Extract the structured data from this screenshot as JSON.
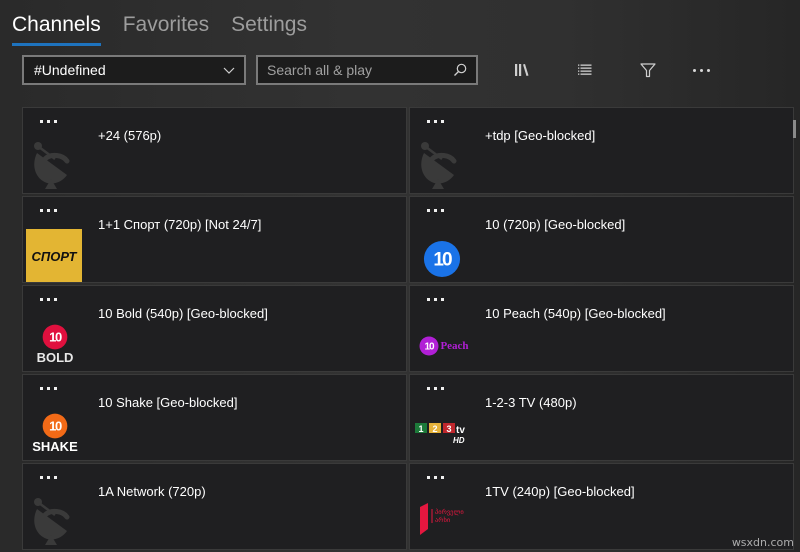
{
  "tabs": [
    {
      "label": "Channels",
      "active": true
    },
    {
      "label": "Favorites",
      "active": false
    },
    {
      "label": "Settings",
      "active": false
    }
  ],
  "toolbar": {
    "group_select_value": "#Undefined",
    "search_placeholder": "Search all & play",
    "search_value": "",
    "icons": [
      "library-icon",
      "list-icon",
      "filter-icon",
      "more-icon"
    ]
  },
  "channels": [
    {
      "title": "+24 (576p)",
      "logo": "satellite-dish"
    },
    {
      "title": "+tdp [Geo-blocked]",
      "logo": "satellite-dish"
    },
    {
      "title": "1+1 Спорт (720p) [Not 24/7]",
      "logo": "sport",
      "logo_text": "СПОРТ",
      "logo_color": "#e3b533"
    },
    {
      "title": "10 (720p) [Geo-blocked]",
      "logo": "ten",
      "logo_color": "#1a73e8"
    },
    {
      "title": "10 Bold (540p) [Geo-blocked]",
      "logo": "ten-bold",
      "logo_text": "BOLD",
      "logo_color": "#e0103e"
    },
    {
      "title": "10 Peach (540p) [Geo-blocked]",
      "logo": "ten-peach",
      "logo_text": "Peach",
      "logo_color": "#b11fd6"
    },
    {
      "title": "10 Shake [Geo-blocked]",
      "logo": "ten-shake",
      "logo_text": "SHAKE",
      "logo_color": "#f26a17"
    },
    {
      "title": "1-2-3 TV (480p)",
      "logo": "one-two-three-tv",
      "logo_text": "tv HD"
    },
    {
      "title": "1A Network (720p)",
      "logo": "satellite-dish"
    },
    {
      "title": "1TV (240p) [Geo-blocked]",
      "logo": "first-channel-georgia",
      "logo_color": "#e5173f"
    }
  ],
  "watermark": "wsxdn.com"
}
